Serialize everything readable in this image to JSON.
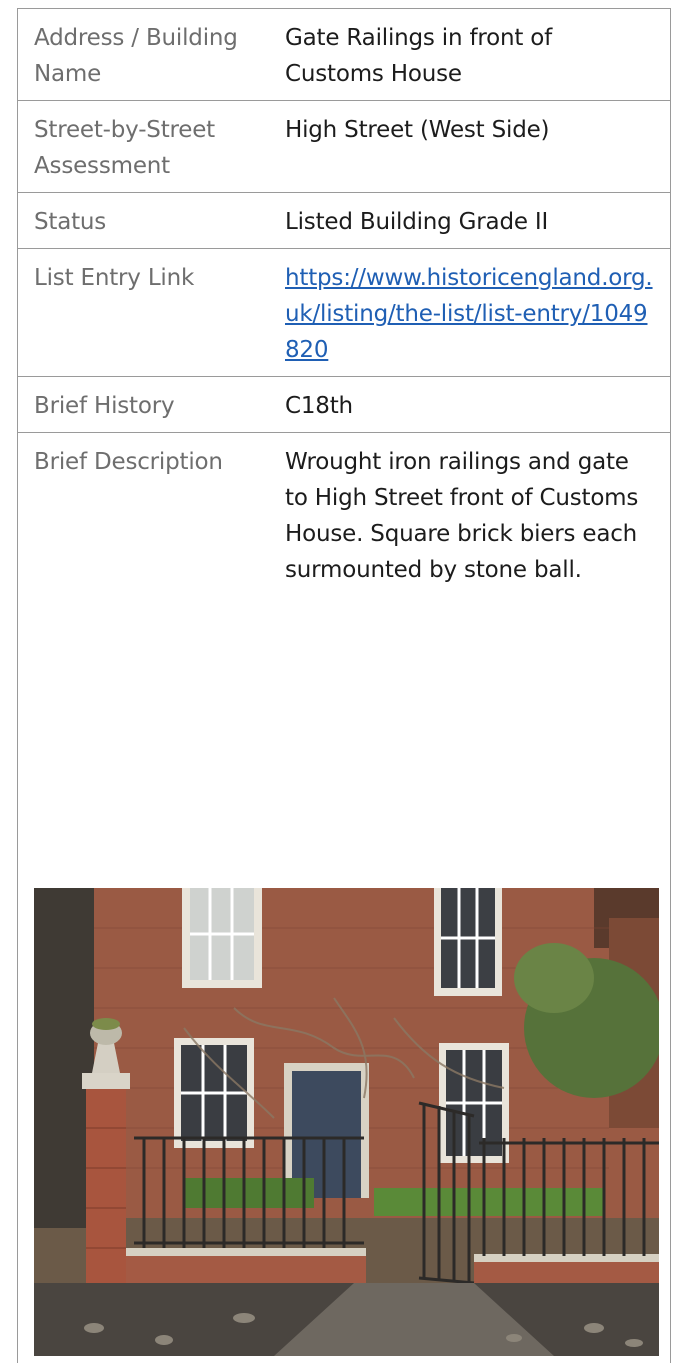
{
  "rows": [
    {
      "label": "Address / Building Name",
      "value": "Gate Railings in front of Customs House"
    },
    {
      "label": "Street-by-Street Assessment",
      "value": "High Street (West Side)"
    },
    {
      "label": "Status",
      "value": "Listed Building Grade II"
    },
    {
      "label": "List Entry Link",
      "value": "https://www.historicengland.org.uk/listing/the-list/list-entry/1049820"
    },
    {
      "label": "Brief History",
      "value": "C18th"
    },
    {
      "label": "Brief Description",
      "value": "Wrought iron railings and gate to High Street front of Customs House. Square brick biers each surmounted by stone ball."
    }
  ],
  "colors": {
    "label_text": "#6e6e6e",
    "value_text": "#1c1c1c",
    "link": "#1f5fb4",
    "rule": "#9a9a9a"
  }
}
